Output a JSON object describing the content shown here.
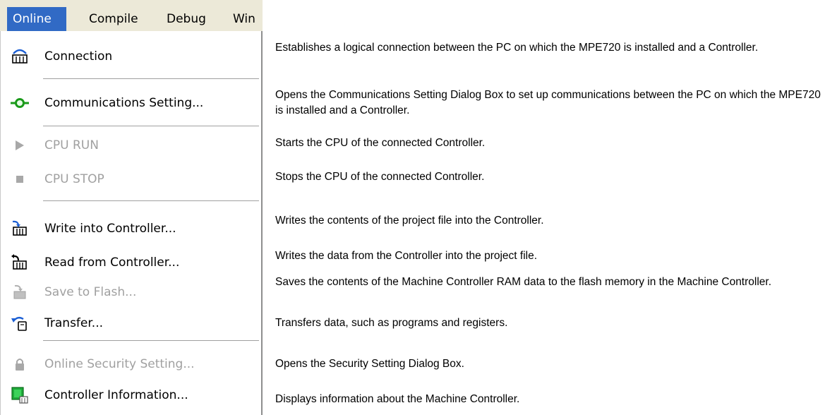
{
  "menubar": {
    "items": [
      {
        "label": "Online",
        "active": true
      },
      {
        "label": "Compile",
        "active": false
      },
      {
        "label": "Debug",
        "active": false
      },
      {
        "label": "Win",
        "active": false
      }
    ]
  },
  "menu": {
    "items": [
      {
        "label": "Connection",
        "icon": "connection-icon",
        "enabled": true
      },
      {
        "label": "Communications Setting...",
        "icon": "communications-setting-icon",
        "enabled": true
      },
      {
        "label": "CPU RUN",
        "icon": "play-icon",
        "enabled": false
      },
      {
        "label": "CPU STOP",
        "icon": "stop-icon",
        "enabled": false
      },
      {
        "label": "Write into Controller...",
        "icon": "write-controller-icon",
        "enabled": true
      },
      {
        "label": "Read from Controller...",
        "icon": "read-controller-icon",
        "enabled": true
      },
      {
        "label": "Save to Flash...",
        "icon": "save-flash-icon",
        "enabled": false
      },
      {
        "label": "Transfer...",
        "icon": "transfer-icon",
        "enabled": true
      },
      {
        "label": "Online Security Setting...",
        "icon": "lock-icon",
        "enabled": false
      },
      {
        "label": "Controller Information...",
        "icon": "controller-info-icon",
        "enabled": true
      }
    ]
  },
  "descriptions": [
    "Establishes a logical connection between the PC on which the MPE720 is installed and a Controller.",
    "Opens the Communications Setting Dialog Box to set up communications between the PC on which the MPE720 is installed and a Controller.",
    "Starts the CPU of the connected Controller.",
    "Stops the CPU of the connected Controller.",
    "Writes the contents of the project file into the Controller.",
    "Writes the data from the Controller into the project file.",
    "Saves the contents of the Machine Controller RAM data to the flash memory in the Machine Controller.",
    "Transfers data, such as programs and registers.",
    "Opens the Security Setting Dialog Box.",
    "Displays information about the Machine Controller."
  ],
  "colors": {
    "menu_highlight": "#316ac5",
    "disabled_text": "#a0a0a0",
    "menubar_bg": "#ece9d8"
  }
}
